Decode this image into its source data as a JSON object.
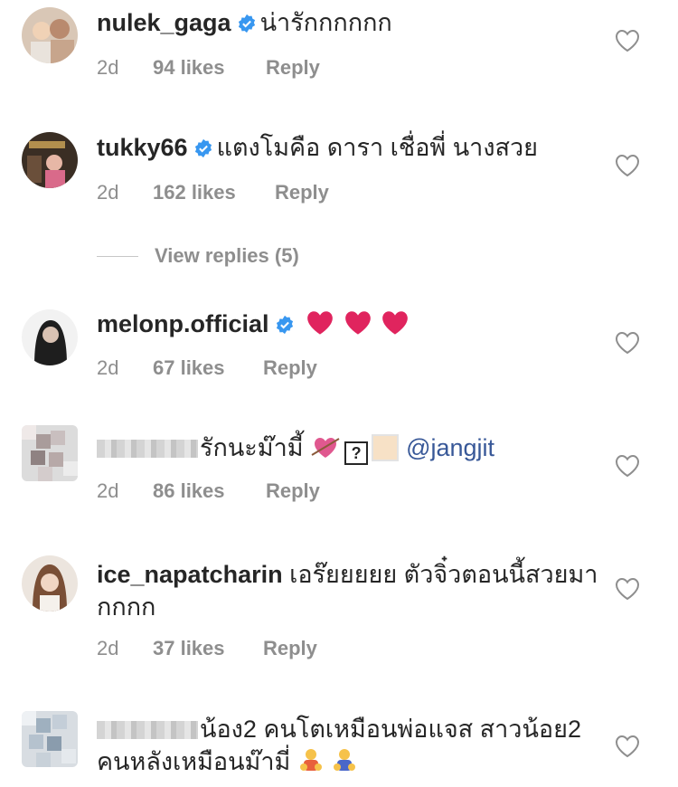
{
  "comments": [
    {
      "username": "nulek_gaga",
      "text": "น่ารักกกกกก",
      "age": "2d",
      "likes": "94 likes",
      "reply": "Reply"
    },
    {
      "username": "tukky66",
      "text": "แตงโมคือ ดารา เชื่อพี่ นางสวย",
      "age": "2d",
      "likes": "162 likes",
      "reply": "Reply"
    },
    {
      "username": "melonp.official",
      "text": "",
      "age": "2d",
      "likes": "67 likes",
      "reply": "Reply"
    },
    {
      "username": "",
      "text": "รักนะม๊ามี้",
      "mention": "@jangjit",
      "age": "2d",
      "likes": "86 likes",
      "reply": "Reply"
    },
    {
      "username": "ice_napatcharin",
      "text": "เอร๊ยยยยย ตัวจิ๋วตอนนี้สวยมากกกก",
      "age": "2d",
      "likes": "37 likes",
      "reply": "Reply"
    },
    {
      "username": "",
      "text": "น้อง2 คนโตเหมือนพ่อแจส สาวน้อย2 คนหลังเหมือนม๊ามี่",
      "age": "",
      "likes": "",
      "reply": ""
    }
  ],
  "view_replies": "View replies (5)",
  "icons": {
    "verified": "verified-badge-icon",
    "like": "heart-outline-icon"
  },
  "colors": {
    "verified": "#3897f0",
    "meta": "#8e8e8e",
    "mention": "#385898",
    "emoji_heart": "#e0245e"
  }
}
